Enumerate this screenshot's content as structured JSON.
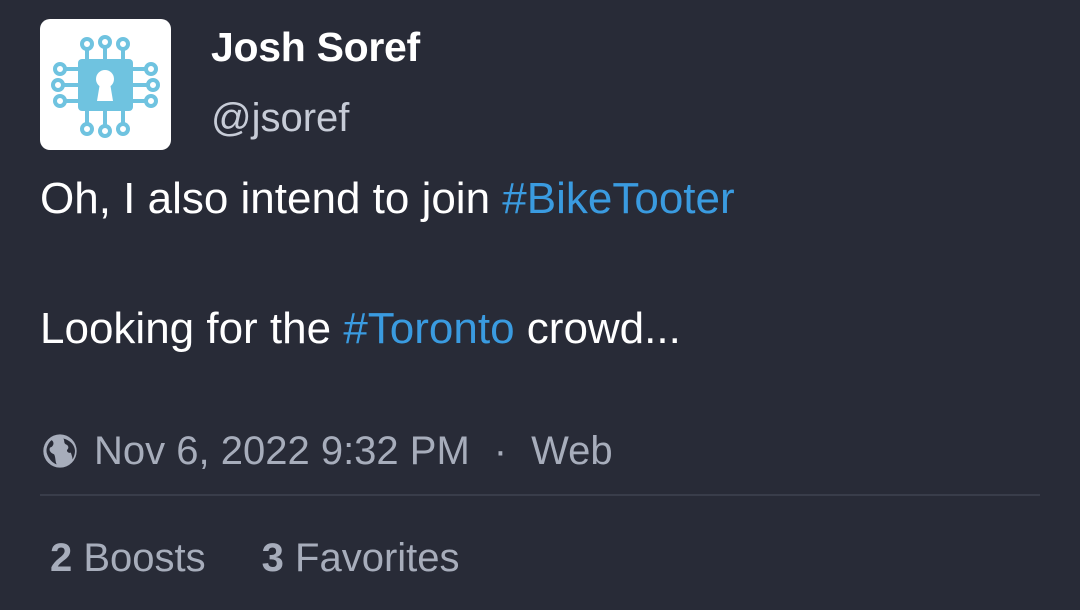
{
  "account": {
    "display_name": "Josh Soref",
    "handle": "@jsoref",
    "avatar_icon": "circuit-keyhole-icon"
  },
  "content": {
    "paragraph1": {
      "text": "Oh, I also intend to join ",
      "hashtag": "#BikeTooter"
    },
    "paragraph2": {
      "text_before": "Looking for the ",
      "hashtag": "#Toronto",
      "text_after": " crowd..."
    }
  },
  "meta": {
    "visibility_icon": "globe-icon",
    "timestamp": "Nov 6, 2022 9:32 PM",
    "separator": "·",
    "application": "Web"
  },
  "stats": {
    "boosts_count": "2",
    "boosts_label": "Boosts",
    "favorites_count": "3",
    "favorites_label": "Favorites"
  },
  "colors": {
    "background": "#282b37",
    "hashtag": "#3a9be0",
    "muted_text": "#a7adbb",
    "avatar_accent": "#6fc3e0"
  }
}
